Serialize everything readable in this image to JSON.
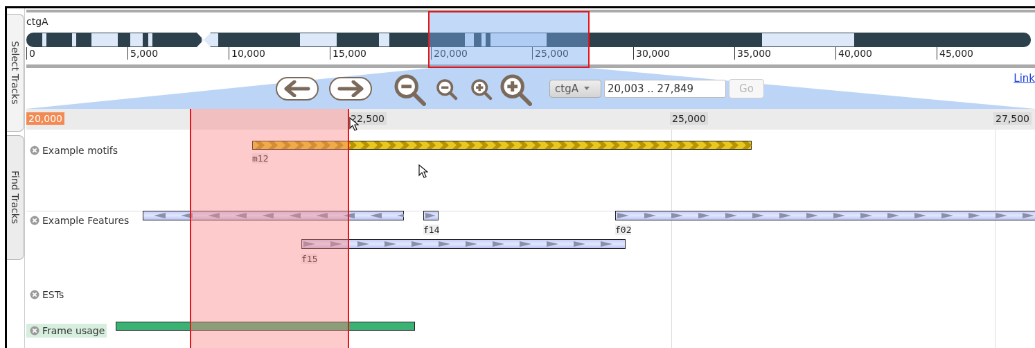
{
  "sidebar_tabs": [
    {
      "label": "Select Tracks",
      "selected": true
    },
    {
      "label": "Find Tracks",
      "selected": false
    }
  ],
  "overview": {
    "reference": "ctgA",
    "ticks": [
      "0",
      "5,000",
      "10,000",
      "15,000",
      "20,000",
      "25,000",
      "30,000",
      "35,000",
      "40,000",
      "45,000"
    ]
  },
  "navigation": {
    "reference_select": "ctgA",
    "location": "20,003 .. 27,849",
    "go_button": {
      "label": "Go",
      "disabled": true
    },
    "link": "Link"
  },
  "ruler": {
    "ticks": [
      {
        "label": "20,000",
        "highlighted": true
      },
      {
        "label": "22,500",
        "highlighted": false
      },
      {
        "label": "25,000",
        "highlighted": false
      },
      {
        "label": "27,500",
        "highlighted": false
      }
    ]
  },
  "tracks": [
    {
      "name": "Example motifs",
      "features": [
        {
          "kind": "motif",
          "label": "m12"
        }
      ]
    },
    {
      "name": "Example Features",
      "features": [
        {
          "kind": "reverse"
        },
        {
          "kind": "forward",
          "label": "f14"
        },
        {
          "kind": "forward",
          "label": "f02"
        },
        {
          "kind": "forward",
          "label": "f15"
        }
      ]
    },
    {
      "name": "ESTs"
    },
    {
      "name": "Frame usage",
      "features": [
        {
          "kind": "score"
        }
      ]
    }
  ]
}
